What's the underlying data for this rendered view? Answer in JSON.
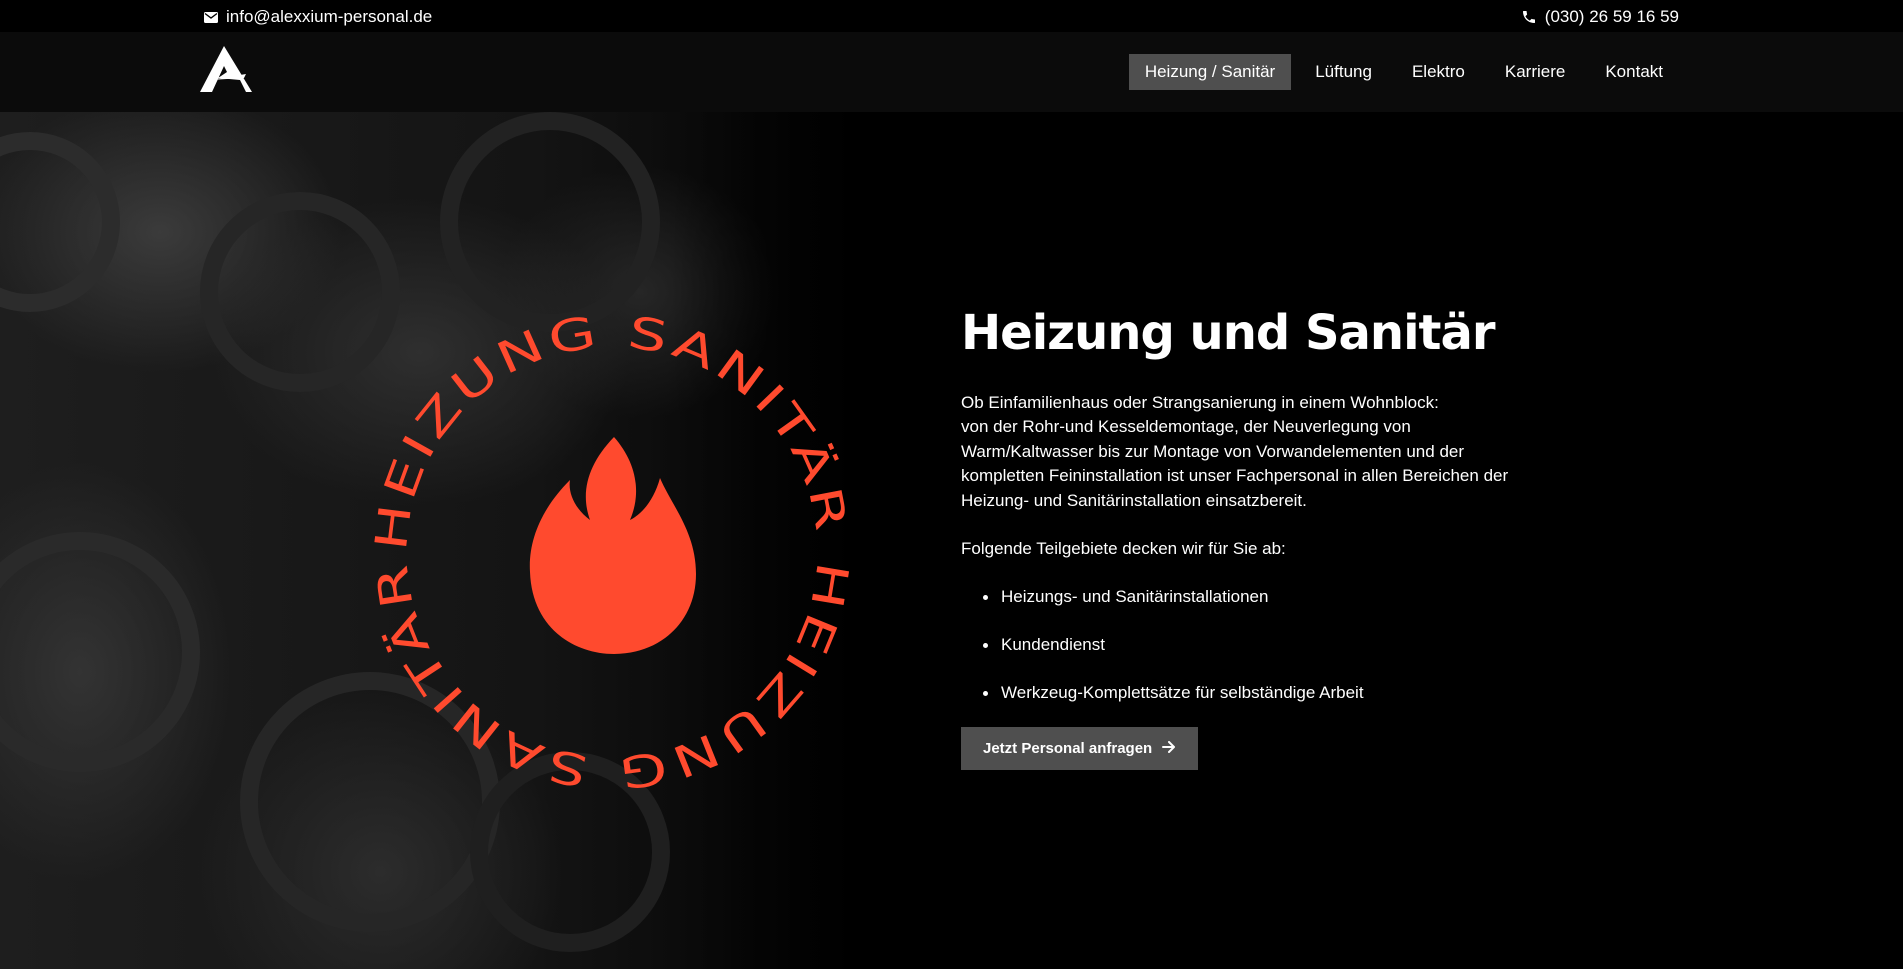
{
  "topbar": {
    "email": "info@alexxium-personal.de",
    "phone": "(030) 26 59 16 59",
    "email_icon": "envelope-icon",
    "phone_icon": "phone-icon"
  },
  "nav": {
    "logo_icon": "alexxium-logo",
    "items": [
      {
        "label": "Heizung / Sanitär",
        "active": true
      },
      {
        "label": "Lüftung"
      },
      {
        "label": "Elektro"
      },
      {
        "label": "Karriere"
      },
      {
        "label": "Kontakt"
      }
    ]
  },
  "badge": {
    "ring_text": "HEIZUNG SANITÄR HEIZUNG SANITÄR",
    "icon": "flame-icon",
    "color": "#ff4a2e"
  },
  "content": {
    "title": "Heizung und Sanitär",
    "intro_line1": "Ob Einfamilienhaus oder Strangsanierung in einem Wohnblock:",
    "intro_line2": "von der Rohr-und Kesseldemontage, der Neuverlegung von Warm/Kaltwasser bis zur Montage von Vorwandelementen und der kompletten Feininstallation ist unser Fachpersonal in allen Bereichen der Heizung- und Sanitärinstallation einsatzbereit.",
    "subheading": "Folgende Teilgebiete decken wir für Sie ab:",
    "list": [
      "Heizungs- und Sanitärinstallationen",
      "Kundendienst",
      "Werkzeug-Komplettsätze für selbständige Arbeit"
    ],
    "cta_label": "Jetzt Personal anfragen",
    "cta_icon": "arrow-right-icon"
  },
  "colors": {
    "accent": "#ff4a2e",
    "nav_active_bg": "#4f4f4f",
    "button_bg": "#4f4f4f",
    "background": "#000000"
  }
}
